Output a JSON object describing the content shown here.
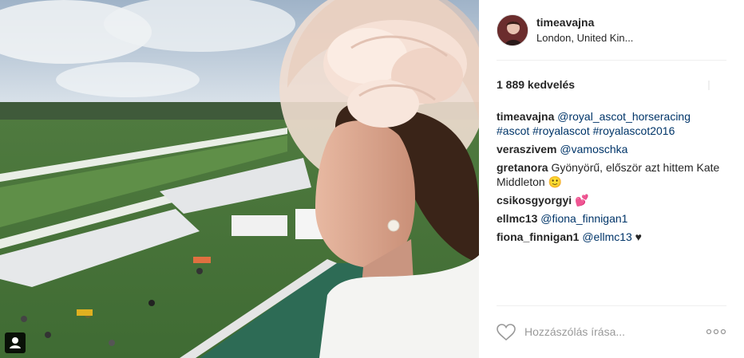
{
  "post": {
    "username": "timeavajna",
    "location": "London, United Kin...",
    "likes_text": "1 889 kedvelés",
    "comments": [
      {
        "user": "timeavajna",
        "parts": [
          {
            "type": "link",
            "text": "@royal_ascot_horseracing"
          },
          {
            "type": "text",
            "text": " "
          },
          {
            "type": "link",
            "text": "#ascot"
          },
          {
            "type": "text",
            "text": " "
          },
          {
            "type": "link",
            "text": "#royalascot"
          },
          {
            "type": "text",
            "text": " "
          },
          {
            "type": "link",
            "text": "#royalascot2016"
          }
        ]
      },
      {
        "user": "veraszivem",
        "parts": [
          {
            "type": "link",
            "text": "@vamoschka"
          }
        ]
      },
      {
        "user": "gretanora",
        "parts": [
          {
            "type": "text",
            "text": "Gyönyörű, először azt hittem Kate Middleton 🙂"
          }
        ]
      },
      {
        "user": "csikosgyorgyi",
        "parts": [
          {
            "type": "text",
            "text": "💕"
          }
        ]
      },
      {
        "user": "ellmc13",
        "parts": [
          {
            "type": "link",
            "text": "@fiona_finnigan1"
          }
        ]
      },
      {
        "user": "fiona_finnigan1",
        "parts": [
          {
            "type": "link",
            "text": "@ellmc13"
          },
          {
            "type": "text",
            "text": " ♥"
          }
        ]
      }
    ],
    "comment_placeholder": "Hozzászólás írása..."
  },
  "icons": {
    "heart": "heart-outline-icon",
    "more": "more-options-icon",
    "tag": "user-tag-icon"
  },
  "colors": {
    "link": "#003569",
    "text": "#262626",
    "muted": "#999999",
    "divider": "#efefef"
  }
}
